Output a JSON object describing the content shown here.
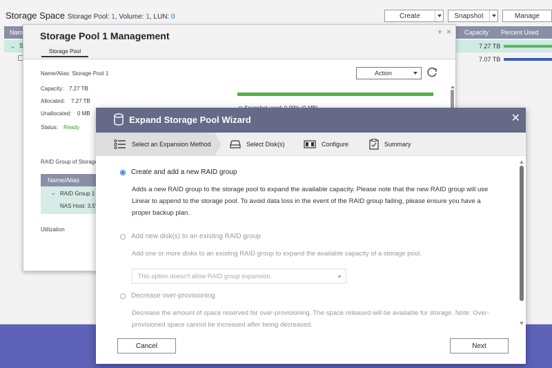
{
  "base": {
    "title": "Storage Space",
    "subtitle_prefix_pool": "Storage Pool: ",
    "pool_count": "1",
    "subtitle_volume": ", Volume: ",
    "volume_count": "1",
    "subtitle_lun": ", LUN: ",
    "lun_count": "0",
    "toolbar": {
      "create": "Create",
      "snapshot": "Snapshot",
      "manage": "Manage"
    },
    "columns": {
      "name": "Nam",
      "capacity": "Capacity",
      "percent_used": "Percent Used"
    },
    "row1": {
      "name": "S",
      "capacity": "7.27 TB",
      "bar_color": "#5cb85c"
    },
    "row2": {
      "capacity": "7.07 TB",
      "bar_color": "#3d5bb5"
    }
  },
  "mgmt": {
    "title": "Storage Pool 1 Management",
    "tab": "Storage Pool",
    "name_alias": "Name/Alias: Storage Pool 1",
    "capacity_label": "Capacity:",
    "capacity_value": "7.27 TB",
    "allocated_label": "Allocated:",
    "allocated_value": "7.27 TB",
    "unallocated_label": "Unallocated:",
    "unallocated_value": "0 MB",
    "status_label": "Status:",
    "status_value": "Ready",
    "action": "Action",
    "snapshot_used": "Snapshot used: 0.00% (0 MB)",
    "raid_group_heading": "RAID Group of Storage P",
    "raid_col": "Name/Alias",
    "raid_item": "RAID Group 1",
    "nas_host": "NAS Host: 3.5\"",
    "utilization": "Utilization",
    "status_color": "#3a9a3a"
  },
  "wizard": {
    "title": "Expand Storage Pool Wizard",
    "steps": [
      {
        "label": "Select an Expansion Method"
      },
      {
        "label": "Select Disk(s)"
      },
      {
        "label": "Configure"
      },
      {
        "label": "Summary"
      }
    ],
    "options": [
      {
        "label": "Create and add a new RAID group",
        "description": "Adds a new RAID group to the storage pool to expand the available capacity. Please note that the new RAID group will use Linear to append to the storage pool. To avoid data loss in the event of the RAID group failing, please ensure you have a proper backup plan.",
        "selected": true
      },
      {
        "label": "Add new disk(s) to an existing RAID group",
        "description": "Add one or more disks to an existing RAID group to expand the available capacity of a storage pool.",
        "select_placeholder": "This option doesn't allow RAID group expansion.",
        "selected": false
      },
      {
        "label": "Decrease over-provisioning",
        "description": "Decrease the amount of space reserved for over-provisioning. The space released will be available for storage. Note: Over-provisioned space cannot be increased after being decreased.",
        "selected": false
      }
    ],
    "cancel": "Cancel",
    "next": "Next"
  },
  "colors": {
    "wizard_header": "#666a88",
    "accent": "#1a6fd0",
    "desktop": "#5d62b8"
  }
}
